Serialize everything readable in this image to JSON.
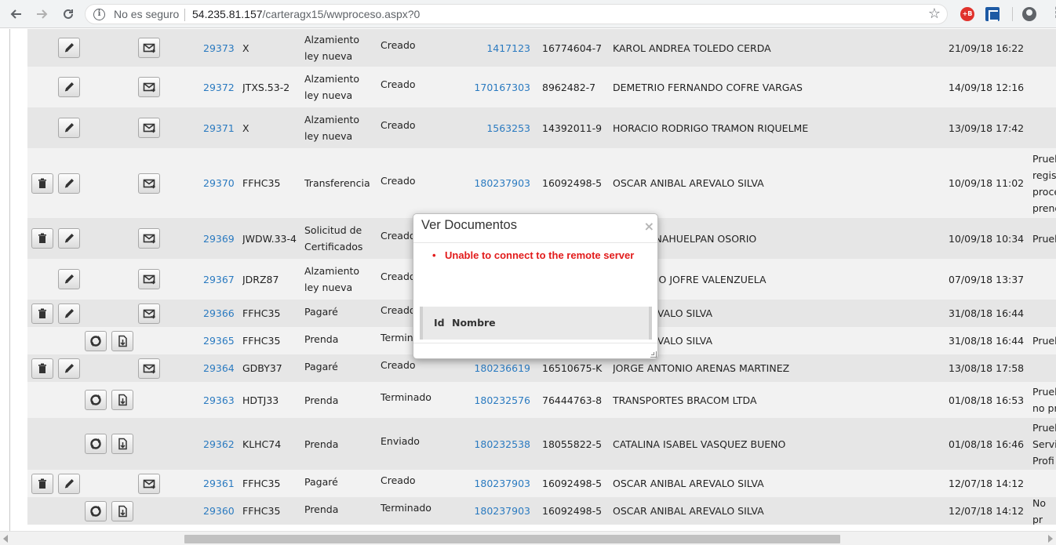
{
  "browser": {
    "security_label": "No es seguro",
    "url_host": "54.235.81.157",
    "url_path": "/carteragx15/wwproceso.aspx?0",
    "ext_red_label": "+B"
  },
  "rows": [
    {
      "id": "29373",
      "plate": "X",
      "type": "Alzamiento ley nueva",
      "status": "Creado",
      "op": "1417123",
      "rut": "16774604-7",
      "name": "KAROL ANDREA TOLEDO CERDA",
      "date": "21/09/18 16:22",
      "obs": ""
    },
    {
      "id": "29372",
      "plate": "JTXS.53-2",
      "type": "Alzamiento ley nueva",
      "status": "Creado",
      "op": "170167303",
      "rut": "8962482-7",
      "name": "DEMETRIO FERNANDO COFRE VARGAS",
      "date": "14/09/18 12:16",
      "obs": ""
    },
    {
      "id": "29371",
      "plate": "X",
      "type": "Alzamiento ley nueva",
      "status": "Creado",
      "op": "1563253",
      "rut": "14392011-9",
      "name": "HORACIO RODRIGO TRAMON RIQUELME",
      "date": "13/09/18 17:42",
      "obs": ""
    },
    {
      "id": "29370",
      "plate": "FFHC35",
      "type": "Transferencia",
      "status": "Creado",
      "op": "180237903",
      "rut": "16092498-5",
      "name": "OSCAR ANIBAL AREVALO SILVA",
      "date": "10/09/18 11:02",
      "obs": "Prueb regist proce prend"
    },
    {
      "id": "29369",
      "plate": "JWDW.33-4",
      "type": "Solicitud de Certificados",
      "status": "Creado",
      "op": "",
      "rut": "",
      "name": "JANDRO NAHUELPAN OSORIO",
      "date": "10/09/18 10:34",
      "obs": "Prueb"
    },
    {
      "id": "29367",
      "plate": "JDRZ87",
      "type": "Alzamiento ley nueva",
      "status": "Creado",
      "op": "",
      "rut": "",
      "name": "L ROSARIO JOFRE VALENZUELA",
      "date": "07/09/18 13:37",
      "obs": ""
    },
    {
      "id": "29366",
      "plate": "FFHC35",
      "type": "Pagaré",
      "status": "Creado",
      "op": "",
      "rut": "",
      "name": "IBAL AREVALO SILVA",
      "date": "31/08/18 16:44",
      "obs": ""
    },
    {
      "id": "29365",
      "plate": "FFHC35",
      "type": "Prenda",
      "status": "Termin",
      "op": "",
      "rut": "",
      "name": "IBAL AREVALO SILVA",
      "date": "31/08/18 16:44",
      "obs": "Prueb"
    },
    {
      "id": "29364",
      "plate": "GDBY37",
      "type": "Pagaré",
      "status": "Creado",
      "op": "180236619",
      "rut": "16510675-K",
      "name": "JORGE ANTONIO ARENAS MARTINEZ",
      "date": "13/08/18 17:58",
      "obs": ""
    },
    {
      "id": "29363",
      "plate": "HDTJ33",
      "type": "Prenda",
      "status": "Terminado",
      "op": "180232576",
      "rut": "76444763-8",
      "name": "TRANSPORTES BRACOM LTDA",
      "date": "01/08/18 16:53",
      "obs": "Prueb no pr"
    },
    {
      "id": "29362",
      "plate": "KLHC74",
      "type": "Prenda",
      "status": "Enviado",
      "op": "180232538",
      "rut": "18055822-5",
      "name": "CATALINA ISABEL VASQUEZ BUENO",
      "date": "01/08/18 16:46",
      "obs": "Prueb Servi Profi"
    },
    {
      "id": "29361",
      "plate": "FFHC35",
      "type": "Pagaré",
      "status": "Creado",
      "op": "180237903",
      "rut": "16092498-5",
      "name": "OSCAR ANIBAL AREVALO SILVA",
      "date": "12/07/18 14:12",
      "obs": ""
    },
    {
      "id": "29360",
      "plate": "FFHC35",
      "type": "Prenda",
      "status": "Terminado",
      "op": "180237903",
      "rut": "16092498-5",
      "name": "OSCAR ANIBAL AREVALO SILVA",
      "date": "12/07/18 14:12",
      "obs": "No pr"
    }
  ],
  "modal": {
    "title": "Ver Documentos",
    "close": "×",
    "error_bullet": "•",
    "error": "Unable to connect to the remote server",
    "col_id": "Id",
    "col_name": "Nombre"
  },
  "colors": {
    "link": "#2a7ac0",
    "error": "#e21b1b",
    "row_even": "#e6e6e6",
    "row_odd": "#f2f2f2"
  }
}
